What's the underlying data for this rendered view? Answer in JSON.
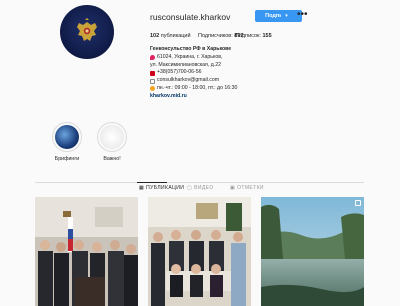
{
  "profile": {
    "username": "rusconsulate.kharkov",
    "subscribe_label": "Подписки",
    "dropdown_icon": "chevron-down-icon",
    "more_icon": "more-dots-icon",
    "stats": {
      "posts_count": "102",
      "posts_label": "публикаций",
      "followers_label": "Подписчиков:",
      "followers_count": "897",
      "following_label": "Подписок:",
      "following_count": "155"
    },
    "bio": {
      "name": "Генконсульство РФ в Харькове",
      "address_line1": "61024, Украина, г. Харьков,",
      "address_line2": "ул. Максимилиановская, д.22",
      "phone": "+38(057)700-06-56",
      "email": "consulkharkov@gmail.com",
      "hours": "пн.-чт.: 09:00 - 18:00, пт.: до 16:30",
      "link": "kharkov.mid.ru"
    }
  },
  "highlights": [
    {
      "label": "Брифинги"
    },
    {
      "label": "Важно!"
    }
  ],
  "tabs": [
    {
      "label": "ПУБЛИКАЦИИ",
      "icon": "grid-icon",
      "active": true
    },
    {
      "label": "ВИДЕО",
      "icon": "video-icon",
      "active": false
    },
    {
      "label": "ОТМЕТКИ",
      "icon": "tag-icon",
      "active": false
    }
  ],
  "colors": {
    "accent": "#3897f0",
    "text": "#262626",
    "muted": "#999999",
    "border": "#dbdbdb",
    "link": "#003569"
  }
}
